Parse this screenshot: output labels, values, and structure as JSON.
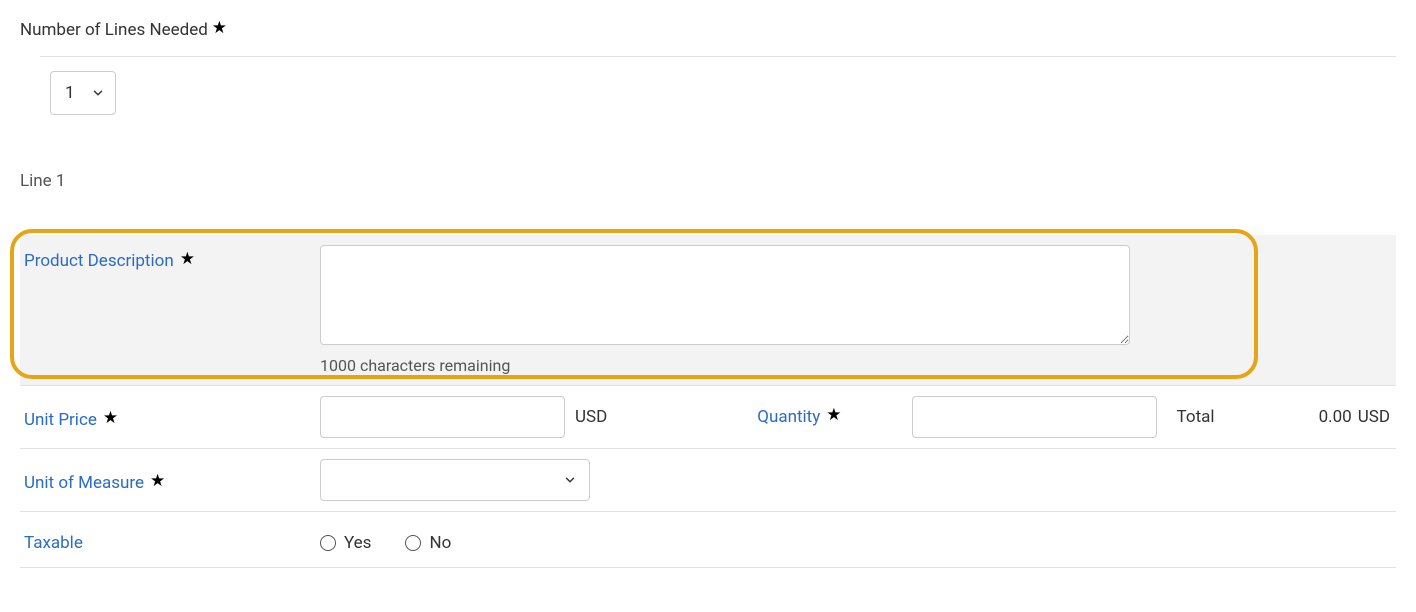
{
  "number_of_lines": {
    "label": "Number of Lines Needed",
    "value": "1"
  },
  "line_title": "Line 1",
  "product_description": {
    "label": "Product Description",
    "value": "",
    "hint": "1000 characters remaining"
  },
  "unit_price": {
    "label": "Unit Price",
    "value": "",
    "currency": "USD"
  },
  "quantity": {
    "label": "Quantity",
    "value": ""
  },
  "total": {
    "label": "Total",
    "value": "0.00",
    "currency": "USD"
  },
  "unit_of_measure": {
    "label": "Unit of Measure",
    "value": ""
  },
  "taxable": {
    "label": "Taxable",
    "option_yes": "Yes",
    "option_no": "No"
  }
}
